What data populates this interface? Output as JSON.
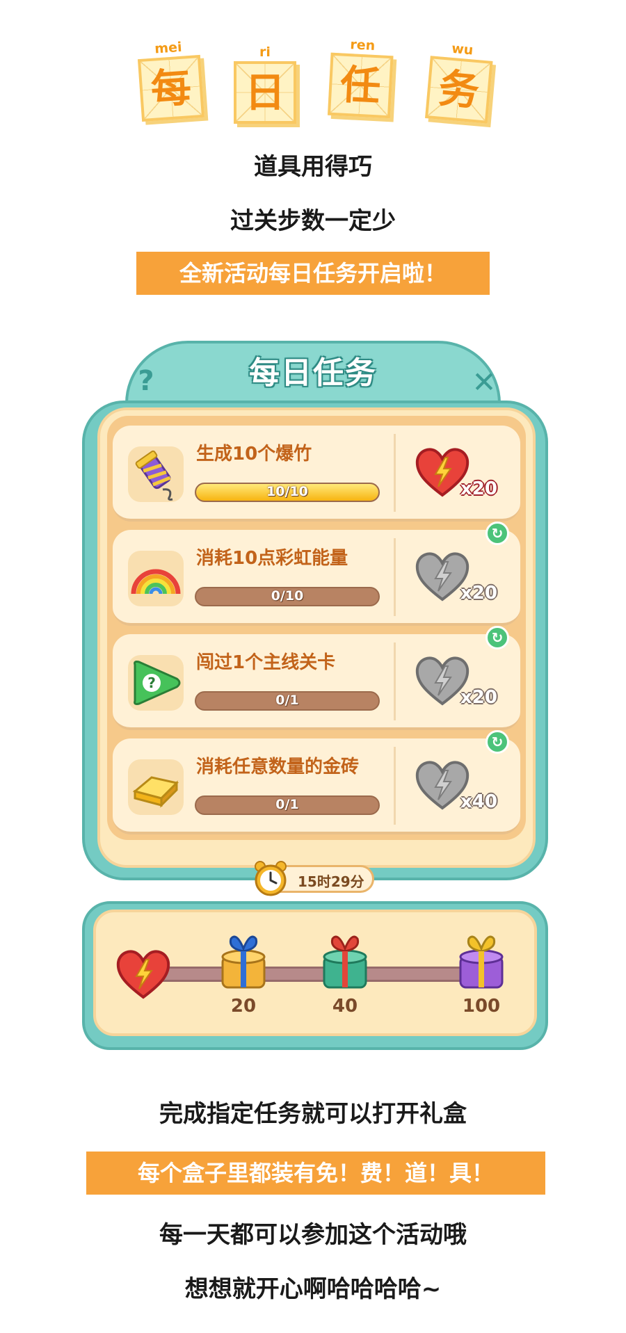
{
  "header": {
    "tiles": [
      {
        "pinyin": "mei",
        "char": "每"
      },
      {
        "pinyin": "ri",
        "char": "日"
      },
      {
        "pinyin": "ren",
        "char": "任"
      },
      {
        "pinyin": "wu",
        "char": "务"
      }
    ],
    "line1": "道具用得巧",
    "line2": "过关步数一定少",
    "banner": "全新活动每日任务开启啦！"
  },
  "panel": {
    "title": "每日任务",
    "help_label": "?",
    "close_label": "✕",
    "tasks": [
      {
        "label": "生成10个爆竹",
        "progress_text": "10/10",
        "progress": 1.0,
        "reward": "x20",
        "complete": true,
        "refreshable": false,
        "icon": "firecracker-icon"
      },
      {
        "label": "消耗10点彩虹能量",
        "progress_text": "0/10",
        "progress": 0,
        "reward": "x20",
        "complete": false,
        "refreshable": true,
        "icon": "rainbow-icon"
      },
      {
        "label": "闯过1个主线关卡",
        "progress_text": "0/1",
        "progress": 0,
        "reward": "x20",
        "complete": false,
        "refreshable": true,
        "icon": "green-candy-icon"
      },
      {
        "label": "消耗任意数量的金砖",
        "progress_text": "0/1",
        "progress": 0,
        "reward": "x40",
        "complete": false,
        "refreshable": true,
        "icon": "gold-bar-icon"
      }
    ],
    "timer": "15时29分"
  },
  "track": {
    "milestones": [
      {
        "value": "20",
        "color": "#f3b43a",
        "ribbon": "#2f6fd6"
      },
      {
        "value": "40",
        "color": "#3fb38f",
        "ribbon": "#e2463a"
      },
      {
        "value": "100",
        "color": "#9d5ed8",
        "ribbon": "#f3c22a"
      }
    ]
  },
  "footer": {
    "line1": "完成指定任务就可以打开礼盒",
    "banner": "每个盒子里都装有免！费！道！具！",
    "line2": "每一天都可以参加这个活动哦",
    "line3": "想想就开心啊哈哈哈哈~"
  },
  "colors": {
    "accent": "#f7a23a",
    "teal": "#74cbc3",
    "heart_red": "#e8423a",
    "heart_gray": "#a3a3a3"
  }
}
